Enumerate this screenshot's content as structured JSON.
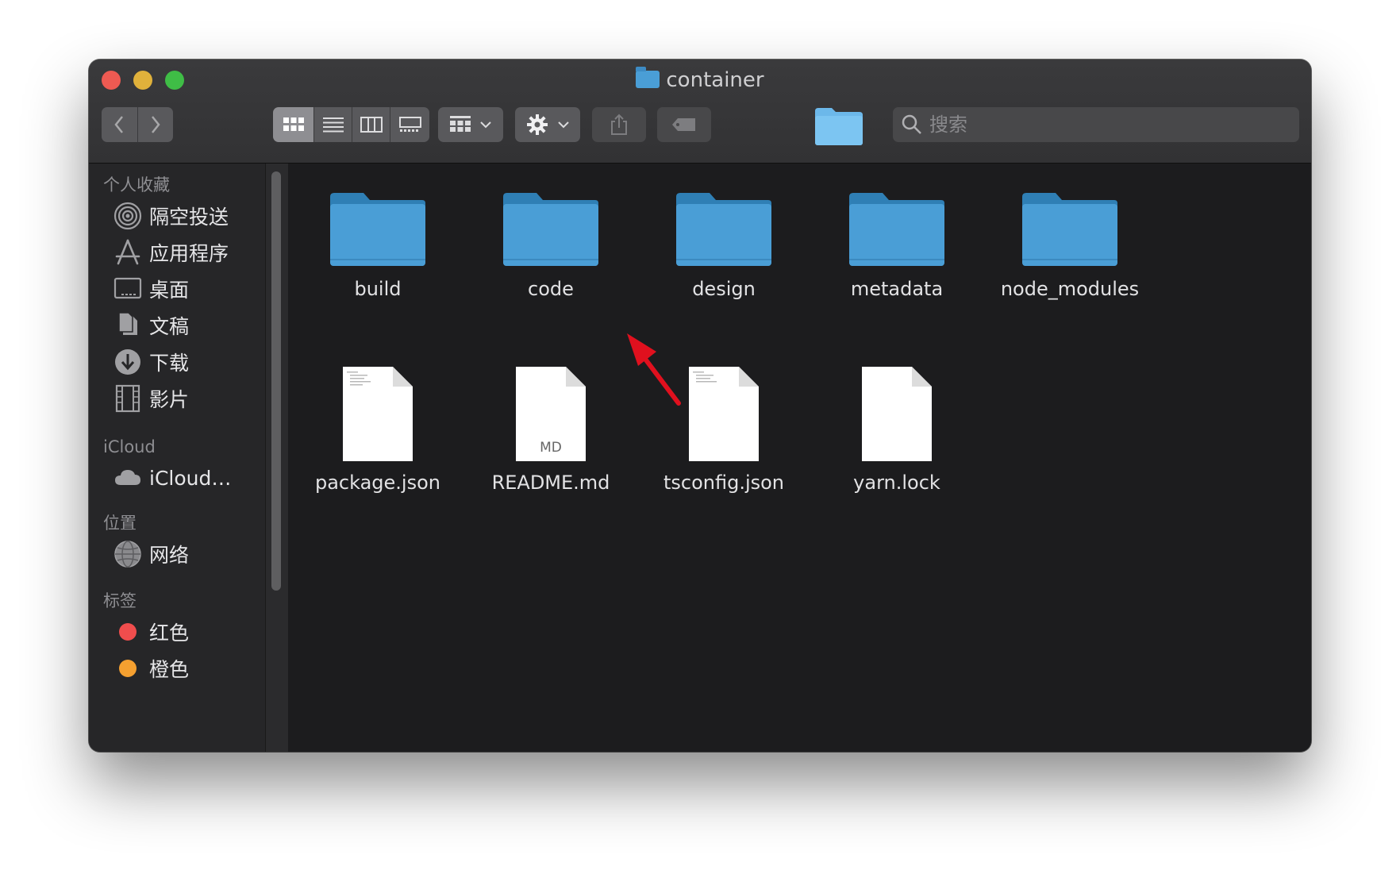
{
  "window": {
    "title": "container"
  },
  "toolbar": {
    "back_icon": "chevron-left-icon",
    "forward_icon": "chevron-right-icon",
    "view_modes": [
      "icon-view",
      "list-view",
      "column-view",
      "gallery-view"
    ],
    "group_icon": "group-by-icon",
    "action_icon": "gear-icon",
    "share_icon": "share-icon",
    "tag_icon": "tag-icon",
    "search_placeholder": "搜索"
  },
  "sidebar": {
    "favorites_header": "个人收藏",
    "favorites": [
      {
        "label": "隔空投送",
        "icon": "airdrop-icon"
      },
      {
        "label": "应用程序",
        "icon": "applications-icon"
      },
      {
        "label": "桌面",
        "icon": "desktop-icon"
      },
      {
        "label": "文稿",
        "icon": "documents-icon"
      },
      {
        "label": "下载",
        "icon": "downloads-icon"
      },
      {
        "label": "影片",
        "icon": "movies-icon"
      }
    ],
    "icloud_header": "iCloud",
    "icloud": [
      {
        "label": "iCloud…",
        "icon": "cloud-icon"
      }
    ],
    "locations_header": "位置",
    "locations": [
      {
        "label": "网络",
        "icon": "network-icon"
      }
    ],
    "tags_header": "标签",
    "tags": [
      {
        "label": "红色",
        "color": "#f04d4d"
      },
      {
        "label": "橙色",
        "color": "#f5a030"
      }
    ]
  },
  "files": {
    "folders": [
      "build",
      "code",
      "design",
      "metadata",
      "node_modules"
    ],
    "documents": [
      {
        "name": "package.json",
        "badge": ""
      },
      {
        "name": "README.md",
        "badge": "MD"
      },
      {
        "name": "tsconfig.json",
        "badge": ""
      },
      {
        "name": "yarn.lock",
        "badge": ""
      }
    ]
  },
  "colors": {
    "accent_arrow": "#e0101e",
    "folder": "#4a9ed6"
  }
}
